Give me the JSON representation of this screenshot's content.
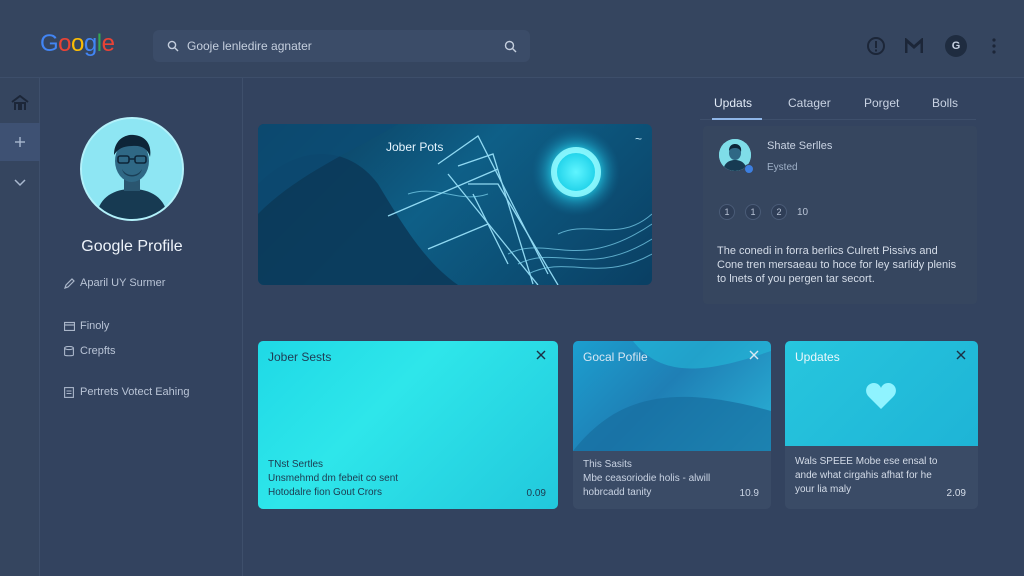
{
  "header": {
    "logo_letters": [
      "G",
      "o",
      "o",
      "g",
      "l",
      "e"
    ],
    "logo_colors": [
      "#4285f4",
      "#ea4335",
      "#fbbc05",
      "#4285f4",
      "#34a853",
      "#ea4335"
    ],
    "search_placeholder": "Gooje lenledire agnater",
    "icons": [
      "info-icon",
      "gmail-icon",
      "account-icon",
      "more-vert-icon"
    ],
    "avatar_letter": "G"
  },
  "rail": {
    "items": [
      "home-icon",
      "add-icon",
      "chevron-down-icon"
    ]
  },
  "profile": {
    "name": "Google Profile",
    "edit_label": "Aparil UY Surmer",
    "menu": [
      {
        "icon": "folder-icon",
        "label": "Finoly"
      },
      {
        "icon": "database-icon",
        "label": "Crepfts"
      },
      {
        "icon": "document-icon",
        "label": "Pertrets Votect Eahing"
      }
    ]
  },
  "hero": {
    "title": "Jober Pots",
    "more": "~"
  },
  "panel": {
    "tabs": [
      "Updats",
      "Catager",
      "Porget",
      "Bolls"
    ],
    "active_tab": 0,
    "feed": {
      "title": "Shate Serlles",
      "subtitle": "Eysted",
      "counts": [
        "1",
        "1",
        "2"
      ],
      "count_total": "10",
      "body": "The conedi in forra berlics Culrett Pissivs and Cone tren mersaeau to hoce for ley sarlidy plenis to lnets of you pergen tar secort."
    }
  },
  "cards": [
    {
      "title": "Jober Sests",
      "body_lines": [
        "TNst Sertles",
        "Unsmehmd dm febeit co sent",
        "Hotodalre fion Gout Crors"
      ],
      "number": "0.09",
      "accent": "#22d8e6"
    },
    {
      "title": "Gocal Pofile",
      "body_lines": [
        "This Sasits",
        "Mbe ceasoriodie holis - alwill",
        "hobrcadd tanity"
      ],
      "number": "10.9",
      "accent": "#1a8fc0"
    },
    {
      "title": "Updates",
      "body_lines": [
        "Wals SPEEE Mobe ese ensal to",
        "ande what cirgahis afhat for he",
        "your lia maly"
      ],
      "number": "2.09",
      "accent": "#1fc1dc"
    }
  ]
}
